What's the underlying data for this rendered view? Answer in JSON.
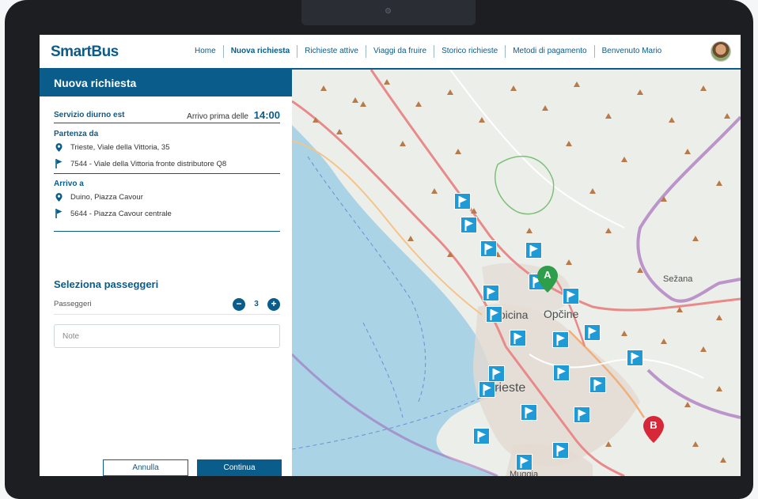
{
  "app": {
    "logo": "SmartBus",
    "nav": [
      "Home",
      "Nuova richiesta",
      "Richieste attive",
      "Viaggi da fruire",
      "Storico richieste",
      "Metodi di pagamento",
      "Benvenuto Mario"
    ],
    "active_nav": "Nuova richiesta"
  },
  "panel": {
    "title": "Nuova richiesta",
    "service": "Servizio diurno est",
    "arrival_prefix": "Arrivo prima delle",
    "arrival_time": "14:00",
    "departure_label": "Partenza da",
    "departure_address": "Trieste, Viale della Vittoria, 35",
    "departure_stop": "7544 - Viale della Vittoria fronte distributore Q8",
    "arrival_label": "Arrivo a",
    "arrival_address": "Duino, Piazza Cavour",
    "arrival_stop": "5644 - Piazza Cavour centrale",
    "passengers_title": "Seleziona passeggeri",
    "passengers_label": "Passeggeri",
    "passengers_count": "3",
    "note_placeholder": "Note",
    "cancel_label": "Annulla",
    "continue_label": "Continua"
  },
  "map": {
    "labels": [
      "Trieste",
      "Opicina",
      "Opčine",
      "Sežana",
      "Muggia"
    ],
    "marker_a": "A",
    "marker_b": "B",
    "colors": {
      "stop": "#1e9ad6",
      "marker_a": "#2e9e4a",
      "marker_b": "#d62839",
      "brand": "#0a5c8a"
    }
  }
}
